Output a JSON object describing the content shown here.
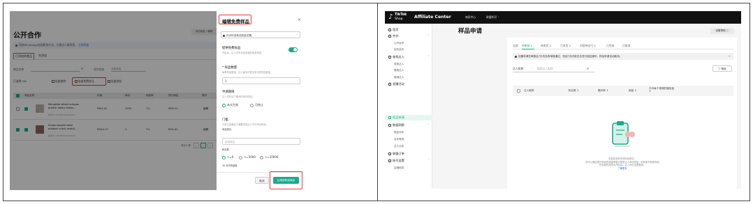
{
  "left": {
    "page_title": "公开合作",
    "top_button": "添加商品 / 编辑",
    "banner_text": "添加WhatsApp电话联系方式，方便达人联系您。",
    "banner_link": "立即添加",
    "tabs": [
      "已添加的商品",
      "未添加"
    ],
    "filter_product_label": "商品名称",
    "filter_status_label": "合作状态",
    "filter_status_value": "全部状态",
    "selected_count": "已选择 2/8",
    "actions": [
      "批量移除",
      "批量免费样品",
      "批量佣金"
    ],
    "table_headers": [
      "商品名称",
      "价格",
      "库存",
      "佣金率",
      "预计佣金",
      "操作"
    ],
    "rows": [
      {
        "name": "Mengkilat disisir kulusan produk dalam takan...",
        "sub": "库存ID 176487462948282",
        "price": "RM4.18",
        "stock": "2999",
        "rate": "7%",
        "earn": "RM0.29",
        "op": "编辑"
      },
      {
        "name": "Snake bassett total outdoor untuk anak&...",
        "sub": "库存ID 176487462948283",
        "price": "RM24.97",
        "stock": "3",
        "rate": "7%",
        "earn": "RM1.80",
        "op": "编辑"
      }
    ],
    "pager_total": "共计1 条",
    "pager_page": "1"
  },
  "drawer": {
    "title": "编辑免费样品",
    "selection_notice": "仅对所选商品批量设置。",
    "toggle_title": "提供免费样品",
    "toggle_sub": "开启后，达人可申请该商品的免费样品。",
    "qty_title": "* 样品数量",
    "qty_sub": "每条样品数量，达人最多可提交申请的样品数量。",
    "qty_value": "1",
    "period_title": "申请期限",
    "period_sub": "达人可在这个期间内申请样品。",
    "period_options": [
      "永久生效",
      "可终止"
    ],
    "threshold_title": "门槛",
    "threshold_sub": "只有达到满足下面要求的达人才可申请样品。",
    "category_label": "商品类目",
    "category_placeholder": "选择类目",
    "fans_label": "粉丝数",
    "fans_options": [
      ">=0",
      ">=5000",
      ">=10000"
    ],
    "fans_note": "30 天内的销量",
    "cancel": "取消",
    "ok": "应用到所选商品"
  },
  "right": {
    "brand_line1": "TikTok",
    "brand_line2": "Shop",
    "app_name": "Affiliate Center",
    "nav": [
      "商家中心",
      "联盟知识 ˅"
    ],
    "sidebar": [
      {
        "type": "group",
        "label": "首页"
      },
      {
        "type": "group",
        "label": "合作"
      },
      {
        "type": "item",
        "label": "公开合作"
      },
      {
        "type": "item",
        "label": "定向合作"
      },
      {
        "type": "group",
        "label": "查找达人"
      },
      {
        "type": "item",
        "label": "查找达人"
      },
      {
        "type": "item",
        "label": "联络达人"
      },
      {
        "type": "item",
        "label": "邀请达人"
      },
      {
        "type": "group",
        "label": "直播活动"
      },
      {
        "type": "group",
        "label": "样品申请"
      },
      {
        "type": "group",
        "label": "数据洞察"
      },
      {
        "type": "item",
        "label": "商品分析"
      },
      {
        "type": "item",
        "label": "合作表现"
      },
      {
        "type": "item",
        "label": "达人分析"
      },
      {
        "type": "group",
        "label": "联盟订单"
      },
      {
        "type": "group",
        "label": "账号设置"
      },
      {
        "type": "item",
        "label": "店铺信息"
      }
    ],
    "page_title": "样品申请",
    "help_button": "查看帮助 ⓘ",
    "tabs": [
      "全部",
      "待审核 0",
      "待发货 0",
      "已发货 0",
      "内容待交付 0",
      "已完成",
      "已取消"
    ],
    "notice": "如果申请在审核后7天内没有审核通过，则该7天内将无法进行相应操作，样品申请自动取消。",
    "filter_select": "达人昵称",
    "filter_placeholder": "搜索达人昵称",
    "filter_button": "筛选",
    "table_headers": [
      "达人昵称",
      "粉丝数 ⇕",
      "履约率 ⇕",
      "销量 ⇕",
      "平均每个视频的播放量 ⇕"
    ],
    "empty_line1": "您目前没有任何样品申请。",
    "empty_line2": "您可以通过提升商品的佣金率吸引更多达人申请样品。向商家开放的商品",
    "empty_line3": "在免费样品申请开启后，达人可在这里看到。",
    "empty_link": "了解更多"
  },
  "accent_color": "#1aab8a",
  "highlight_color": "#e83b3b"
}
